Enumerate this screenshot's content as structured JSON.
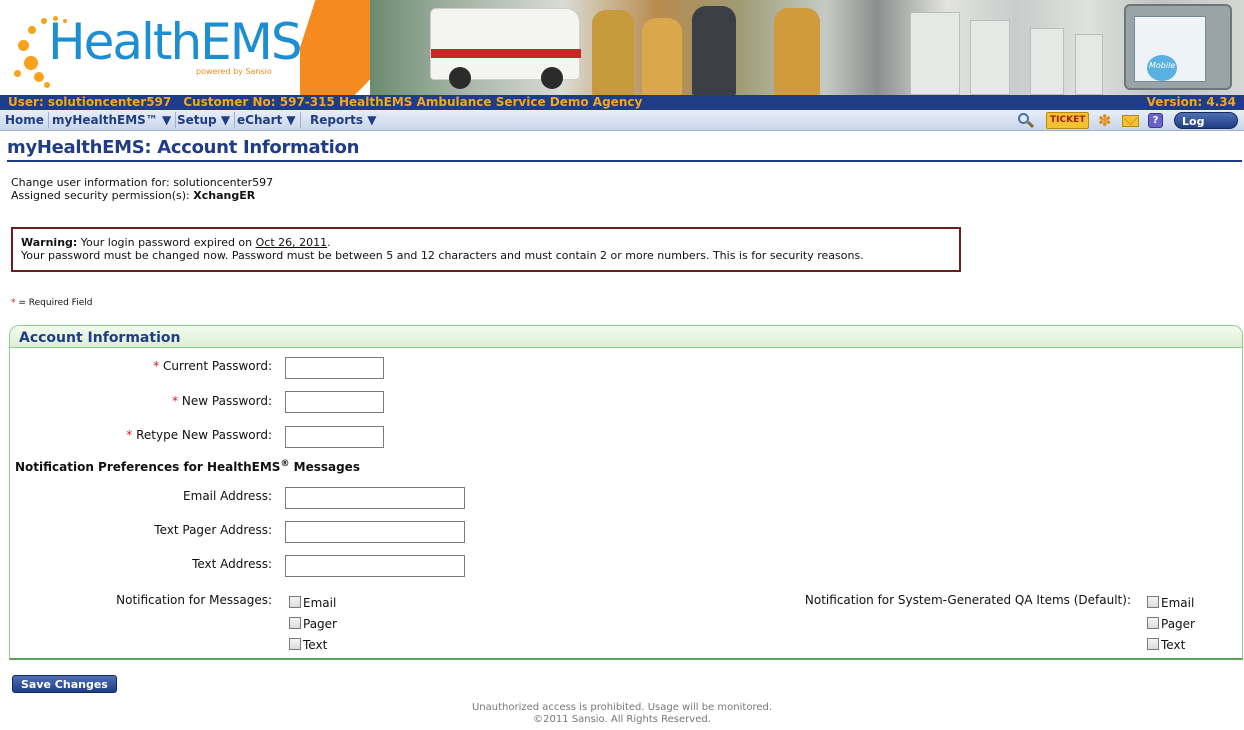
{
  "brand": {
    "logo_text": "HealthEMS",
    "logo_tagline": "powered by Sansio",
    "device_label": "Mobile",
    "orange": "#f58a1f",
    "blue": "#1c8ed1"
  },
  "userbar": {
    "user": "User: solutioncenter597",
    "customer": "Customer No: 597-315 HealthEMS Ambulance Service Demo Agency",
    "version": "Version: 4.34"
  },
  "menu": {
    "items": [
      {
        "label": "Home"
      },
      {
        "label": "myHealthEMS™ ▼"
      },
      {
        "label": "Setup ▼"
      },
      {
        "label": "eChart ▼"
      },
      {
        "label": "Reports ▼"
      }
    ],
    "toolbar": {
      "search_icon": "magnifier-icon",
      "ticket_label": "TICKET",
      "star_icon": "star-of-life-icon",
      "mail_icon": "envelope-icon",
      "help_label": "?",
      "logout_label": "Log Out"
    }
  },
  "page": {
    "title": "myHealthEMS: Account Information",
    "change_user_label": "Change user information for: solutioncenter597",
    "permissions_label": "Assigned security permission(s):",
    "permissions_value": "XchangER"
  },
  "warning": {
    "lead": "Warning:",
    "line1_text": " Your login password expired on ",
    "expire_date": "Oct 26, 2011",
    "line1_end": ".",
    "line2": "Your password must be changed now. Password must be between 5 and 12 characters and must contain 2 or more numbers. This is for security reasons."
  },
  "required_note": {
    "star": "*",
    "text": " = Required Field"
  },
  "form": {
    "panel_title": "Account Information",
    "current_password_label": "Current Password:",
    "new_password_label": "New Password:",
    "retype_password_label": "Retype New Password:",
    "notification_heading": "Notification Preferences for HealthEMS",
    "notification_heading_mark": "®",
    "notification_heading_tail": " Messages",
    "email_label": "Email Address:",
    "pager_label": "Text Pager Address:",
    "text_label": "Text Address:",
    "notify_messages_label": "Notification for Messages:",
    "notify_qa_label": "Notification for System-Generated QA Items (Default):",
    "options": [
      "Email",
      "Pager",
      "Text"
    ],
    "values": {
      "current_password": "",
      "new_password": "",
      "retype_password": "",
      "email": "",
      "pager": "",
      "text": ""
    }
  },
  "actions": {
    "save_label": "Save Changes"
  },
  "footer": {
    "line1": "Unauthorized access is prohibited. Usage will be monitored.",
    "line2": "©2011 Sansio. All Rights Reserved."
  }
}
